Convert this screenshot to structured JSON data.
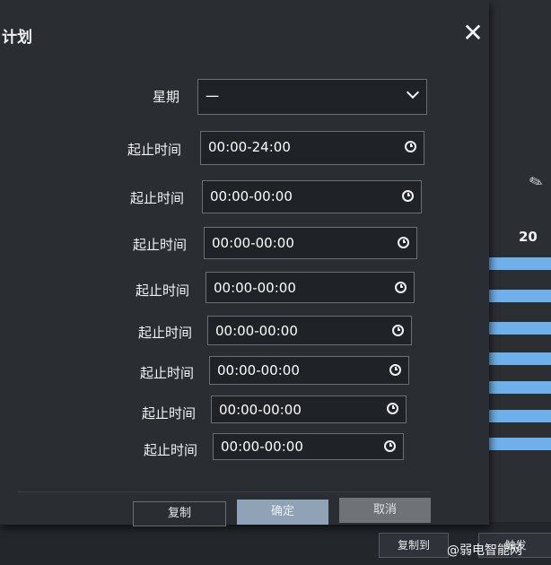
{
  "dialog": {
    "title": "计划",
    "weekday": {
      "label": "星期",
      "value": "一"
    },
    "rows": [
      {
        "label": "起止时间",
        "value": "00:00-24:00"
      },
      {
        "label": "起止时间",
        "value": "00:00-00:00"
      },
      {
        "label": "起止时间",
        "value": "00:00-00:00"
      },
      {
        "label": "起止时间",
        "value": "00:00-00:00"
      },
      {
        "label": "起止时间",
        "value": "00:00-00:00"
      },
      {
        "label": "起止时间",
        "value": "00:00-00:00"
      },
      {
        "label": "起止时间",
        "value": "00:00-00:00"
      },
      {
        "label": "起止时间",
        "value": "00:00-00:00"
      }
    ],
    "buttons": {
      "copy": "复制",
      "ok": "确定",
      "cancel": "取消"
    }
  },
  "background": {
    "hour_label": "20",
    "copy_to": "复制到",
    "partial_button": "触发"
  },
  "watermark": "@弱电智能网",
  "colors": {
    "timeline_bar": "#6fb0ea",
    "ok_button": "#8fa2b6"
  }
}
